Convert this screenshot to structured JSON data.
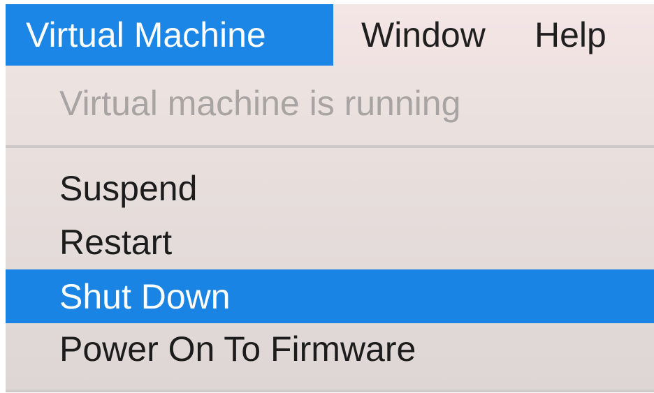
{
  "menubar": {
    "items": [
      {
        "label": "Virtual Machine",
        "active": true
      },
      {
        "label": "Window",
        "active": false
      },
      {
        "label": "Help",
        "active": false
      }
    ]
  },
  "menu": {
    "status": "Virtual machine is running",
    "items": [
      {
        "label": "Suspend",
        "highlighted": false
      },
      {
        "label": "Restart",
        "highlighted": false
      },
      {
        "label": "Shut Down",
        "highlighted": true
      },
      {
        "label": "Power On To Firmware",
        "highlighted": false
      }
    ]
  },
  "colors": {
    "highlight": "#1a84e4",
    "menu_background": "#ede3e1",
    "disabled_text": "#a8a4a3"
  }
}
